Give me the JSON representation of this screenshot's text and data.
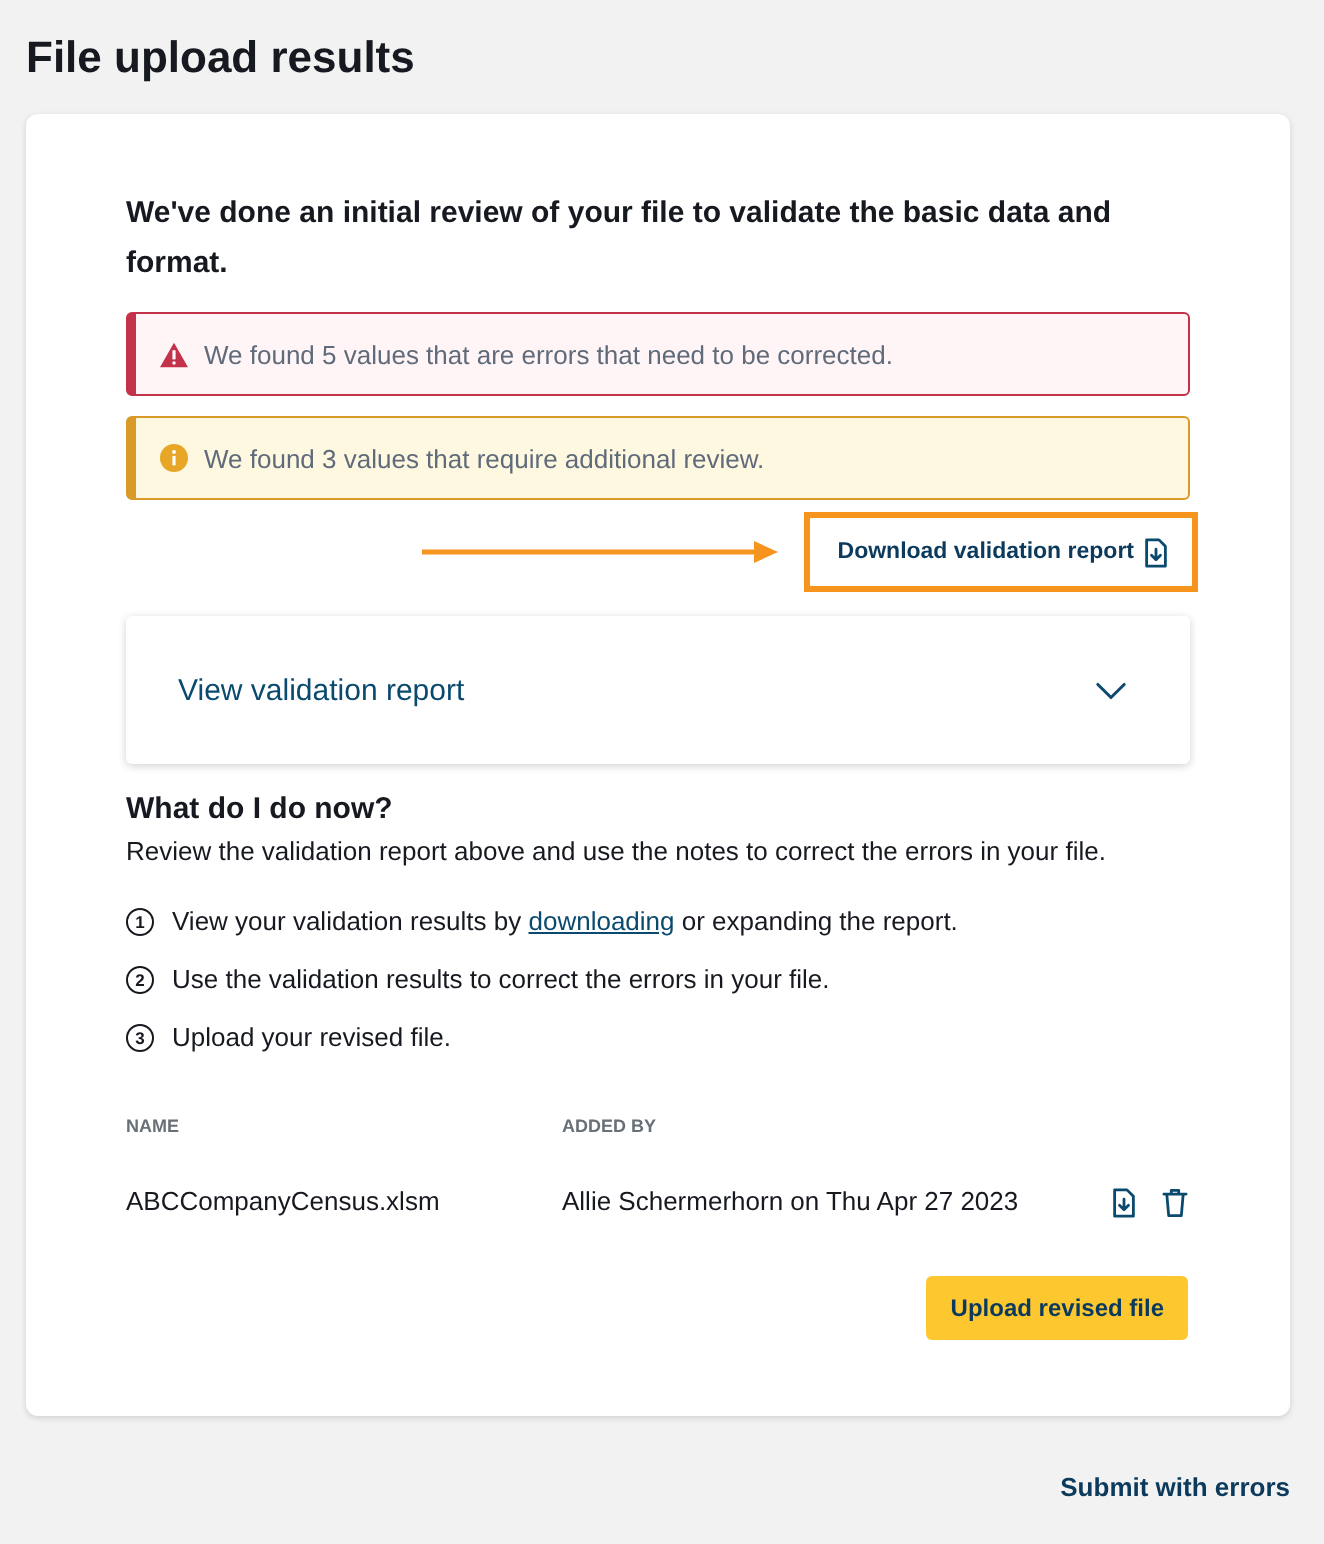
{
  "page": {
    "title": "File upload results"
  },
  "intro": "We've done an initial review of your file to validate the basic data and format.",
  "alerts": [
    {
      "kind": "error",
      "text": "We found 5 values that are errors that need to be corrected."
    },
    {
      "kind": "warning",
      "text": "We found 3 values that require additional review."
    }
  ],
  "download_link": {
    "label": "Download validation report",
    "highlighted": true
  },
  "accordion": {
    "title": "View validation report",
    "expanded": false
  },
  "help": {
    "heading": "What do I do now?",
    "text": "Review the validation report above and use the notes to correct the errors in your file.",
    "steps": [
      {
        "number": "1",
        "text": "View your validation results by ",
        "link": "downloading",
        "after": " or expanding the report."
      },
      {
        "number": "2",
        "text": "Use the validation results to correct the errors in your file."
      },
      {
        "number": "3",
        "text": "Upload your revised file."
      }
    ]
  },
  "table": {
    "columns": [
      "NAME",
      "ADDED BY"
    ],
    "rows": [
      {
        "cells": [
          "ABCCompanyCensus.xlsm",
          "Allie Schermerhorn on Thu Apr 27 2023"
        ]
      }
    ]
  },
  "primary_button": {
    "label": "Upload revised file"
  },
  "footer_link": {
    "label": "Submit with errors"
  }
}
